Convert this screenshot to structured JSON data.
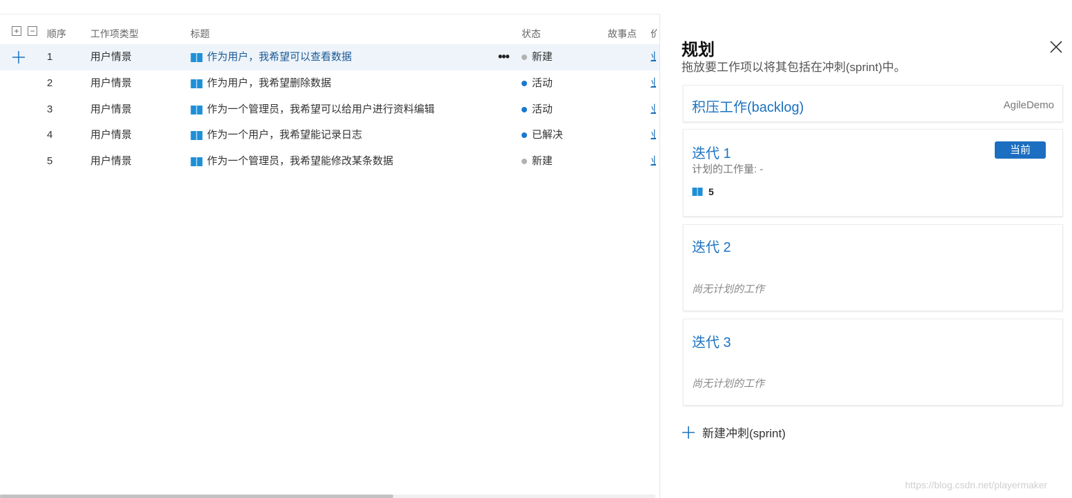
{
  "grid": {
    "columns": {
      "order": "顺序",
      "type": "工作项类型",
      "title": "标题",
      "state": "状态",
      "points": "故事点",
      "cut": "价"
    },
    "rows": [
      {
        "order": "1",
        "type": "用户情景",
        "title": "作为用户，我希望可以查看数据",
        "state": "新建",
        "state_color": "#b2b2b2",
        "cut": "业",
        "selected": true
      },
      {
        "order": "2",
        "type": "用户情景",
        "title": "作为用户，我希望删除数据",
        "state": "活动",
        "state_color": "#1a78d0",
        "cut": "业"
      },
      {
        "order": "3",
        "type": "用户情景",
        "title": "作为一个管理员，我希望可以给用户进行资料编辑",
        "state": "活动",
        "state_color": "#1a78d0",
        "cut": "业"
      },
      {
        "order": "4",
        "type": "用户情景",
        "title": "作为一个用户，我希望能记录日志",
        "state": "已解决",
        "state_color": "#1a78d0",
        "cut": "业"
      },
      {
        "order": "5",
        "type": "用户情景",
        "title": "作为一个管理员，我希望能修改某条数据",
        "state": "新建",
        "state_color": "#b2b2b2",
        "cut": "业"
      }
    ],
    "more_glyph": "•••"
  },
  "panel": {
    "title": "规划",
    "subtitle": "拖放要工作项以将其包括在冲刺(sprint)中。",
    "backlog": {
      "title": "积压工作(backlog)",
      "team": "AgileDemo"
    },
    "sprints": [
      {
        "title": "迭代 1",
        "badge": "当前",
        "meta": "计划的工作量: -",
        "count": "5"
      },
      {
        "title": "迭代 2",
        "empty": "尚无计划的工作"
      },
      {
        "title": "迭代 3",
        "empty": "尚无计划的工作"
      }
    ],
    "new_sprint": "新建冲刺(sprint)"
  },
  "watermark": "https://blog.csdn.net/playermaker",
  "colors": {
    "accent": "#1b72c0",
    "badge": "#1b6ec0",
    "selected_row": "#eef4fa",
    "book_icon": "#1f8fd6"
  }
}
